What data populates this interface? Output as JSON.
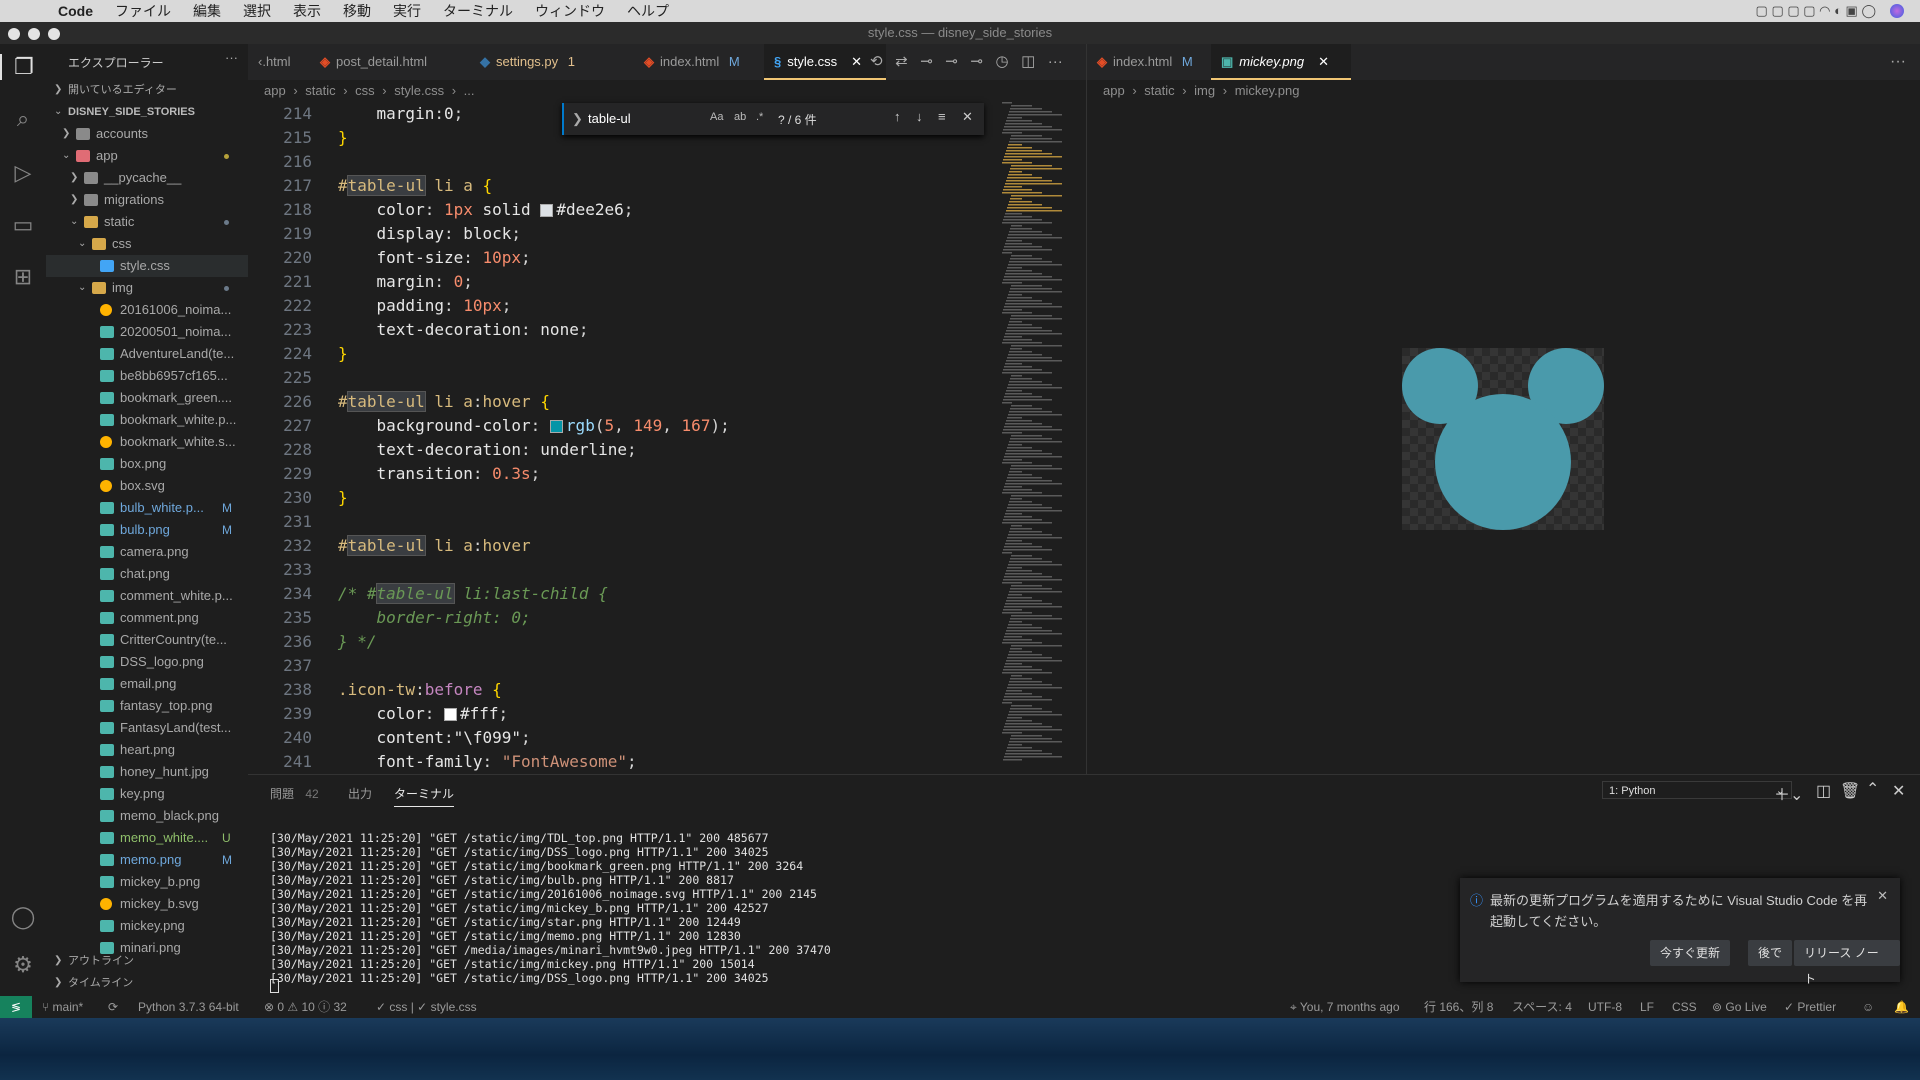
{
  "menubar": {
    "app_name": "Code",
    "items": [
      "ファイル",
      "編集",
      "選択",
      "表示",
      "移動",
      "実行",
      "ターミナル",
      "ウィンドウ",
      "ヘルプ"
    ]
  },
  "window_title": "style.css — disney_side_stories",
  "sidebar": {
    "title": "エクスプローラー",
    "open_editors": "開いているエディター",
    "project": "DISNEY_SIDE_STORIES",
    "tree": [
      {
        "label": "accounts",
        "type": "folder",
        "depth": 1
      },
      {
        "label": "app",
        "type": "folder-open",
        "depth": 1,
        "color": "#e06c75"
      },
      {
        "label": "__pycache__",
        "type": "folder",
        "depth": 2
      },
      {
        "label": "migrations",
        "type": "folder",
        "depth": 2
      },
      {
        "label": "static",
        "type": "folder-open",
        "depth": 2
      },
      {
        "label": "css",
        "type": "folder-open",
        "depth": 3
      },
      {
        "label": "style.css",
        "type": "css",
        "depth": 4
      },
      {
        "label": "img",
        "type": "folder-open",
        "depth": 3
      },
      {
        "label": "20161006_noima...",
        "type": "svg",
        "depth": 4
      },
      {
        "label": "20200501_noima...",
        "type": "img",
        "depth": 4
      },
      {
        "label": "AdventureLand(te...",
        "type": "img",
        "depth": 4
      },
      {
        "label": "be8bb6957cf165...",
        "type": "img",
        "depth": 4
      },
      {
        "label": "bookmark_green....",
        "type": "img",
        "depth": 4
      },
      {
        "label": "bookmark_white.p...",
        "type": "img",
        "depth": 4
      },
      {
        "label": "bookmark_white.s...",
        "type": "svg",
        "depth": 4
      },
      {
        "label": "box.png",
        "type": "img",
        "depth": 4
      },
      {
        "label": "box.svg",
        "type": "svg",
        "depth": 4
      },
      {
        "label": "bulb_white.p...",
        "type": "img",
        "depth": 4,
        "badge": "M"
      },
      {
        "label": "bulb.png",
        "type": "img",
        "depth": 4,
        "badge": "M"
      },
      {
        "label": "camera.png",
        "type": "img",
        "depth": 4
      },
      {
        "label": "chat.png",
        "type": "img",
        "depth": 4
      },
      {
        "label": "comment_white.p...",
        "type": "img",
        "depth": 4
      },
      {
        "label": "comment.png",
        "type": "img",
        "depth": 4
      },
      {
        "label": "CritterCountry(te...",
        "type": "img",
        "depth": 4
      },
      {
        "label": "DSS_logo.png",
        "type": "img",
        "depth": 4
      },
      {
        "label": "email.png",
        "type": "img",
        "depth": 4
      },
      {
        "label": "fantasy_top.png",
        "type": "img",
        "depth": 4
      },
      {
        "label": "FantasyLand(test...",
        "type": "img",
        "depth": 4
      },
      {
        "label": "heart.png",
        "type": "img",
        "depth": 4
      },
      {
        "label": "honey_hunt.jpg",
        "type": "img",
        "depth": 4
      },
      {
        "label": "key.png",
        "type": "img",
        "depth": 4
      },
      {
        "label": "memo_black.png",
        "type": "img",
        "depth": 4
      },
      {
        "label": "memo_white....",
        "type": "img",
        "depth": 4,
        "badge": "U"
      },
      {
        "label": "memo.png",
        "type": "img",
        "depth": 4,
        "badge": "M"
      },
      {
        "label": "mickey_b.png",
        "type": "img",
        "depth": 4
      },
      {
        "label": "mickey_b.svg",
        "type": "svg",
        "depth": 4
      },
      {
        "label": "mickey.png",
        "type": "img",
        "depth": 4
      },
      {
        "label": "minari.png",
        "type": "img",
        "depth": 4
      }
    ],
    "outline": "アウトライン",
    "timeline": "タイムライン"
  },
  "tabs_left": [
    {
      "label": "‹.html",
      "icon": ""
    },
    {
      "label": "post_detail.html",
      "icon": "html",
      "badge": ""
    },
    {
      "label": "settings.py",
      "icon": "py",
      "badge": "1"
    },
    {
      "label": "index.html",
      "icon": "html",
      "badge": "M"
    },
    {
      "label": "style.css",
      "icon": "css",
      "badge": "",
      "active": true
    }
  ],
  "breadcrumb_left": [
    "app",
    "static",
    "css",
    "style.css",
    "..."
  ],
  "find": {
    "query": "table-ul",
    "result": "? / 6 件"
  },
  "code_lines": [
    {
      "n": "214",
      "html": "    <span class='prop2'>margin</span>:<span class='prop2'>0</span>;"
    },
    {
      "n": "215",
      "html": "<span class='brace'>}</span>"
    },
    {
      "n": "216",
      "html": ""
    },
    {
      "n": "217",
      "html": "<span class='sel-id'>#<span class='match'>table-ul</span></span> <span class='kw'>li a</span> <span class='brace'>{</span>"
    },
    {
      "n": "218",
      "html": "    <span class='prop2'>color</span>: <span class='num2'>1px</span> <span class='prop2'>solid</span> <span class='swatch' style='background:#dee2e6'></span><span class='prop2'>#dee2e6</span>;"
    },
    {
      "n": "219",
      "html": "    <span class='prop2'>display</span>: <span class='prop2'>block</span>;"
    },
    {
      "n": "220",
      "html": "    <span class='prop2'>font-size</span>: <span class='num2'>10px</span>;"
    },
    {
      "n": "221",
      "html": "    <span class='prop2'>margin</span>: <span class='num2'>0</span>;"
    },
    {
      "n": "222",
      "html": "    <span class='prop2'>padding</span>: <span class='num2'>10px</span>;"
    },
    {
      "n": "223",
      "html": "    <span class='prop2'>text-decoration</span>: <span class='prop2'>none</span>;"
    },
    {
      "n": "224",
      "html": "<span class='brace'>}</span>"
    },
    {
      "n": "225",
      "html": ""
    },
    {
      "n": "226",
      "html": "<span class='sel-id'>#<span class='match'>table-ul</span></span> <span class='kw'>li a</span>:<span class='kw'>hover</span> <span class='brace'>{</span>"
    },
    {
      "n": "227",
      "html": "    <span class='prop2'>background-color</span>: <span class='swatch' style='background:#0595a7'></span><span class='prop'>rgb</span>(<span class='num2'>5</span>, <span class='num2'>149</span>, <span class='num2'>167</span>);"
    },
    {
      "n": "228",
      "html": "    <span class='prop2'>text-decoration</span>: <span class='prop2'>underline</span>;"
    },
    {
      "n": "229",
      "html": "    <span class='prop2'>transition</span>: <span class='num2'>0.3s</span>;"
    },
    {
      "n": "230",
      "html": "<span class='brace'>}</span>"
    },
    {
      "n": "231",
      "html": ""
    },
    {
      "n": "232",
      "html": "<span class='sel-id'>#<span class='match'>table-ul</span></span> <span class='kw'>li a</span>:<span class='kw'>hover</span>"
    },
    {
      "n": "233",
      "html": ""
    },
    {
      "n": "234",
      "html": "<span class='comment'>/* #<span class='match'>table-ul</span> li:last-child {</span>"
    },
    {
      "n": "235",
      "html": "<span class='comment'>    border-right: 0;</span>"
    },
    {
      "n": "236",
      "html": "<span class='comment'>} */</span>"
    },
    {
      "n": "237",
      "html": ""
    },
    {
      "n": "238",
      "html": "<span class='kw'>.icon-tw</span>:<span class='pseudo'>before</span> <span class='brace'>{</span>"
    },
    {
      "n": "239",
      "html": "    <span class='prop2'>color</span>: <span class='swatch' style='background:#ffffff'></span><span class='prop2'>#fff</span>;"
    },
    {
      "n": "240",
      "html": "    <span class='prop2'>content</span>:<span class='prop2'>\"\\f099\"</span>;"
    },
    {
      "n": "241",
      "html": "    <span class='prop2'>font-family</span>: <span class='str'>\"FontAwesome\"</span>;"
    }
  ],
  "tabs_right": [
    {
      "label": "index.html",
      "icon": "html",
      "badge": "M"
    },
    {
      "label": "mickey.png",
      "icon": "img",
      "active": true
    }
  ],
  "breadcrumb_right": [
    "app",
    "static",
    "img",
    "mickey.png"
  ],
  "preview_color": "#4a9aab",
  "panel": {
    "tabs": [
      "問題",
      "出力",
      "ターミナル"
    ],
    "problems_count": "42",
    "terminal_select": "1: Python",
    "lines": [
      "[30/May/2021 11:25:20] \"GET /static/img/TDL_top.png HTTP/1.1\" 200 485677",
      "[30/May/2021 11:25:20] \"GET /static/img/DSS_logo.png HTTP/1.1\" 200 34025",
      "[30/May/2021 11:25:20] \"GET /static/img/bookmark_green.png HTTP/1.1\" 200 3264",
      "[30/May/2021 11:25:20] \"GET /static/img/bulb.png HTTP/1.1\" 200 8817",
      "[30/May/2021 11:25:20] \"GET /static/img/20161006_noimage.svg HTTP/1.1\" 200 2145",
      "[30/May/2021 11:25:20] \"GET /static/img/mickey_b.png HTTP/1.1\" 200 42527",
      "[30/May/2021 11:25:20] \"GET /static/img/star.png HTTP/1.1\" 200 12449",
      "[30/May/2021 11:25:20] \"GET /static/img/memo.png HTTP/1.1\" 200 12830",
      "[30/May/2021 11:25:20] \"GET /media/images/minari_hvmt9w0.jpeg HTTP/1.1\" 200 37470",
      "[30/May/2021 11:25:20] \"GET /static/img/mickey.png HTTP/1.1\" 200 15014",
      "[30/May/2021 11:25:20] \"GET /static/img/DSS_logo.png HTTP/1.1\" 200 34025"
    ]
  },
  "notification": {
    "message": "最新の更新プログラムを適用するために Visual Studio Code を再起動してください。",
    "buttons": [
      "今すぐ更新",
      "後で",
      "リリース ノート"
    ]
  },
  "statusbar": {
    "branch": "main*",
    "python": "Python 3.7.3 64-bit",
    "problems": "⊗ 0 ⚠ 10 ⓘ 32",
    "lang_check": "✓ css | ✓ style.css",
    "blame": "You, 7 months ago",
    "position": "行 166、列 8",
    "spaces": "スペース: 4",
    "encoding": "UTF-8",
    "eol": "LF",
    "language": "CSS",
    "golive": "Go Live",
    "prettier": "✓ Prettier"
  }
}
